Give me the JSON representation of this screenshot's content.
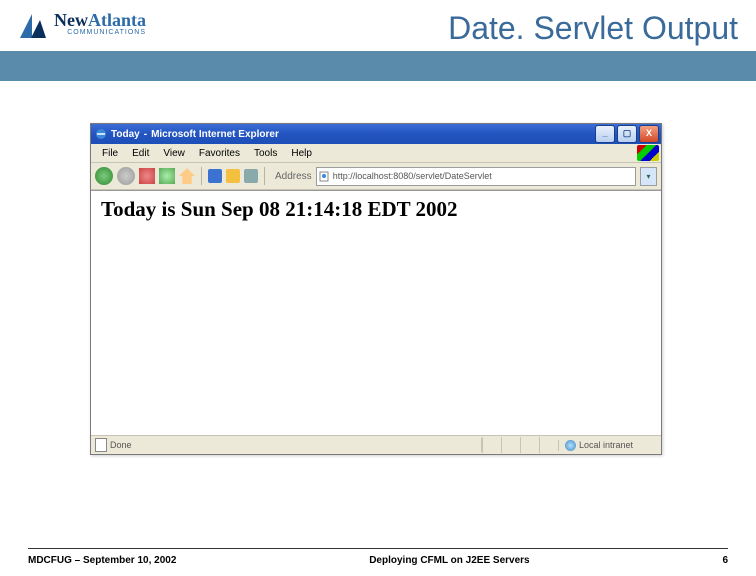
{
  "header": {
    "logo_main": "New",
    "logo_sub": "Atlanta",
    "logo_small": "COMMUNICATIONS",
    "slide_title": "Date. Servlet Output"
  },
  "ie": {
    "titlebar": {
      "page_title": "Today",
      "app_name": "Microsoft Internet Explorer"
    },
    "winbtns": {
      "min": "_",
      "max": "▢",
      "close": "X"
    },
    "menu": [
      "File",
      "Edit",
      "View",
      "Favorites",
      "Tools",
      "Help"
    ],
    "toolbar": {
      "address_label": "Address",
      "url": "http://localhost:8080/servlet/DateServlet",
      "dropdown": "▾"
    },
    "content": {
      "body_text": "Today is Sun Sep 08 21:14:18 EDT 2002"
    },
    "status": {
      "left": "Done",
      "right": "Local intranet"
    }
  },
  "footer": {
    "left": "MDCFUG – September 10, 2002",
    "center": "Deploying CFML on J2EE Servers",
    "right": "6"
  }
}
